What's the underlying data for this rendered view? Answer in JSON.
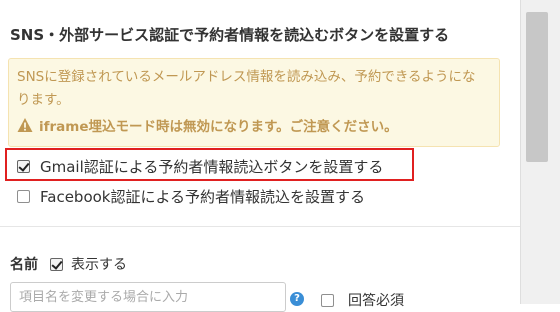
{
  "section": {
    "title": "SNS・外部サービス認証で予約者情報を読込むボタンを設置する"
  },
  "notice": {
    "text": "SNSに登録されているメールアドレス情報を読み込み、予約できるようになります。",
    "warning": "iframe埋込モード時は無効になります。ご注意ください。",
    "warning_icon": "warning-triangle-icon",
    "background_color": "#fcf8e3",
    "text_color": "#c09853"
  },
  "options": {
    "gmail": {
      "label": "Gmail認証による予約者情報読込ボタンを設置する",
      "checked": true
    },
    "facebook": {
      "label": "Facebook認証による予約者情報読込を設置する",
      "checked": false
    }
  },
  "highlight": {
    "color": "#e02020"
  },
  "name_field": {
    "label": "名前",
    "display_label": "表示する",
    "display_checked": true,
    "input_placeholder": "項目名を変更する場合に入力",
    "input_value": "",
    "help_icon": "help-icon",
    "required_label": "回答必須",
    "required_checked": false
  }
}
